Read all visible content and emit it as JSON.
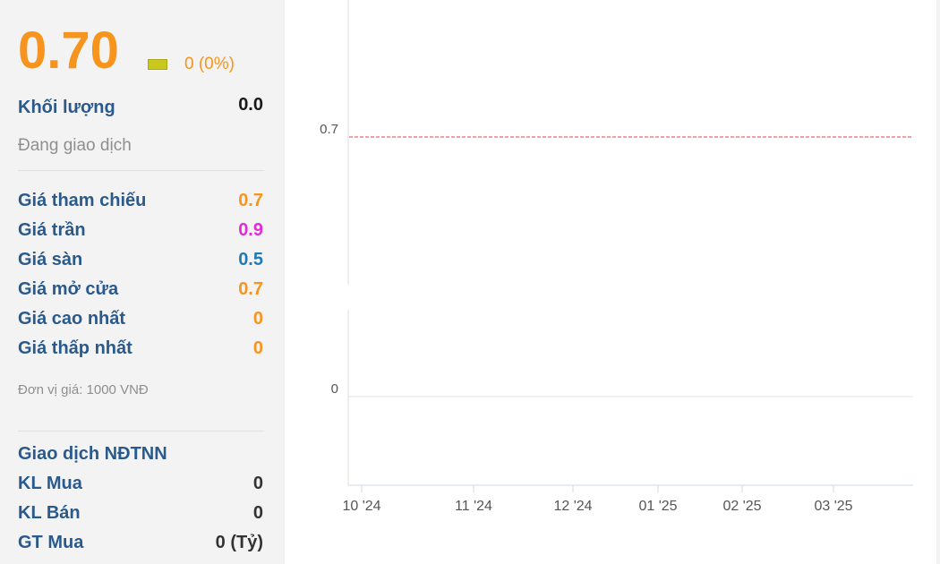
{
  "quote": {
    "price": "0.70",
    "change": "0 (0%)",
    "volume_label": "Khối lượng",
    "volume_value": "0.0",
    "status": "Đang giao dịch"
  },
  "prices": [
    {
      "label": "Giá tham chiếu",
      "value": "0.7",
      "color": "#f7941d"
    },
    {
      "label": "Giá trần",
      "value": "0.9",
      "color": "#e02bd6"
    },
    {
      "label": "Giá sàn",
      "value": "0.5",
      "color": "#1f7bb6"
    },
    {
      "label": "Giá mở cửa",
      "value": "0.7",
      "color": "#f7941d"
    },
    {
      "label": "Giá cao nhất",
      "value": "0",
      "color": "#f7941d"
    },
    {
      "label": "Giá thấp nhất",
      "value": "0",
      "color": "#f7941d"
    }
  ],
  "unit_note": "Đơn vị giá: 1000 VNĐ",
  "foreign": {
    "title": "Giao dịch NĐTNN",
    "rows": [
      {
        "label": "KL Mua",
        "value": "0"
      },
      {
        "label": "KL Bán",
        "value": "0"
      },
      {
        "label": "GT Mua",
        "value": "0 (Tỷ)"
      }
    ]
  },
  "chart_data": {
    "type": "line",
    "x_ticks": [
      "10 '24",
      "11 '24",
      "12 '24",
      "01 '25",
      "02 '25",
      "03 '25"
    ],
    "y_ticks": [
      "0.7",
      "0"
    ],
    "reference_line": 0.7,
    "reference_color": "#e04040"
  }
}
